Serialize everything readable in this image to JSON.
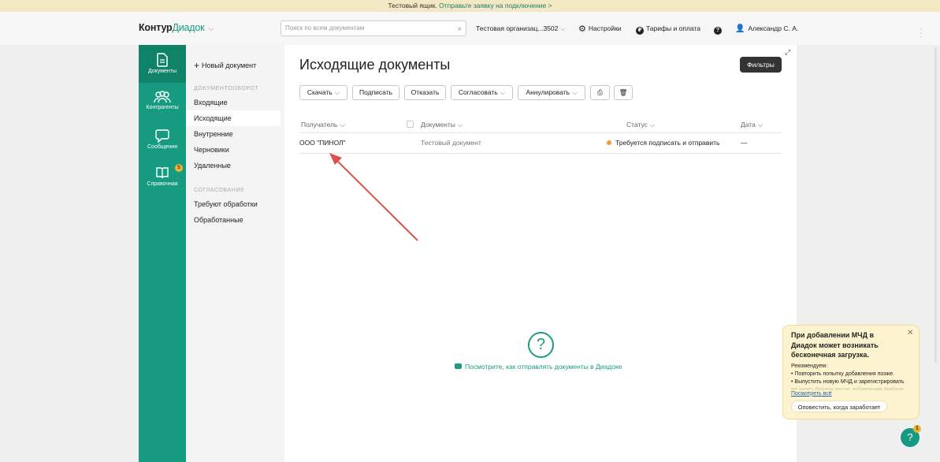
{
  "banner": {
    "text": "Тестовый ящик.",
    "link": "Отправьте заявку на подключение >"
  },
  "header": {
    "logo_part1": "Контур",
    "logo_part2": "Диадок",
    "search_placeholder": "Поиск по всем документам",
    "org": "Тестовая организац...3502",
    "settings": "Настройки",
    "tariffs": "Тарифы и оплата",
    "user": "Александр С. А."
  },
  "nav": {
    "items": [
      {
        "label": "Документы"
      },
      {
        "label": "Контрагенты"
      },
      {
        "label": "Сообщения"
      },
      {
        "label": "Справочная",
        "badge": "5"
      }
    ]
  },
  "sidebar": {
    "new_doc": "Новый документ",
    "section1": "ДОКУМЕНТООБОРОТ",
    "items1": [
      "Входящие",
      "Исходящие",
      "Внутренние",
      "Черновики",
      "Удаленные"
    ],
    "section2": "СОГЛАСОВАНИЕ",
    "items2": [
      "Требуют обработки",
      "Обработанные"
    ]
  },
  "main": {
    "title": "Исходящие документы",
    "filters": "Фильтры",
    "toolbar": [
      "Скачать",
      "Подписать",
      "Отказать",
      "Согласовать",
      "Аннулировать"
    ],
    "columns": {
      "recipient": "Получатель",
      "documents": "Документы",
      "status": "Статус",
      "date": "Дата"
    },
    "rows": [
      {
        "recipient": "ООО \"ПИНОЛ\"",
        "document": "Тестовый документ",
        "status": "Требуется подписать и отправить",
        "date": "—"
      }
    ],
    "video_link": "Посмотрите, как отправлять документы в Диадоке"
  },
  "notice": {
    "title": "При добавлении МЧД в Диадок может возникать бесконечная загрузка.",
    "recommend": "Рекомендуем:",
    "bullet1": "• Повторить попытку добавления позже.",
    "bullet2": "• Выпустить новую МЧД и зарегистрировать",
    "bullet3_faded": "её через Диадок после добавления файлов",
    "more": "Посмотреть всё",
    "button": "Оповестить, когда заработает"
  },
  "help_badge": "1",
  "colors": {
    "accent": "#169b80",
    "status_orange": "#f39a38",
    "arrow": "#d9534f"
  }
}
